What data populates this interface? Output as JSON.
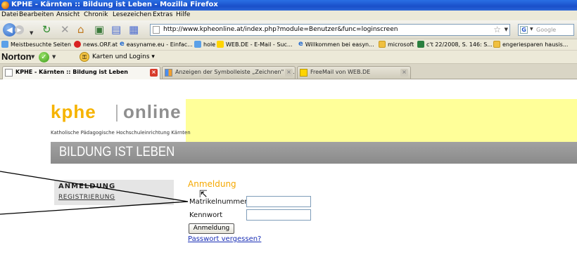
{
  "window": {
    "title": "KPHE - Kärnten :: Bildung ist Leben - Mozilla Firefox"
  },
  "menu": [
    "Datei",
    "Bearbeiten",
    "Ansicht",
    "Chronik",
    "Lesezeichen",
    "Extras",
    "Hilfe"
  ],
  "navigation": {
    "url": "http://www.kpheonline.at/index.php?module=Benutzer&func=loginscreen",
    "search_placeholder": "Google"
  },
  "bookmarks": [
    {
      "label": "Meistbesuchte Seiten",
      "icon": "page-icon"
    },
    {
      "label": "news.ORF.at",
      "icon": "orf-icon"
    },
    {
      "label": "easyname.eu - Einfac...",
      "icon": "ie-icon"
    },
    {
      "label": "hole",
      "icon": "hole-icon"
    },
    {
      "label": "WEB.DE - E-Mail - Suc...",
      "icon": "webde-icon"
    },
    {
      "label": "Willkommen bei easyn...",
      "icon": "ie-icon"
    },
    {
      "label": "microsoft",
      "icon": "folder-icon"
    },
    {
      "label": "c't 22/2008, S. 146: S...",
      "icon": "ct-icon"
    },
    {
      "label": "engeriesparen hausis...",
      "icon": "folder-icon"
    }
  ],
  "norton": {
    "brand": "Norton",
    "logins_label": "Karten und Logins"
  },
  "tabs": [
    {
      "label": "KPHE - Kärnten :: Bildung ist Leben",
      "active": true
    },
    {
      "label": "Anzeigen der Symbolleiste „Zeichnen\" - ...",
      "active": false
    },
    {
      "label": "FreeMail von WEB.DE",
      "active": false
    }
  ],
  "page": {
    "logo_part1": "kphe",
    "logo_part2": "online",
    "logo_subtitle": "Katholische Pädagogische Hochschuleinrichtung Kärnten",
    "banner": "BILDUNG IST LEBEN",
    "sidebar": {
      "anmeldung": "ANMELDUNG",
      "registrierung": "REGISTRIERUNG"
    },
    "login": {
      "title": "Anmeldung",
      "matrikel_label": "Matrikelnummer",
      "matrikel_value": "",
      "kennwort_label": "Kennwort",
      "kennwort_value": "",
      "button": "Anmeldung",
      "forgot": "Passwort vergessen?"
    }
  },
  "colors": {
    "accent": "#f5a800",
    "logo_grey": "#8f8f8f",
    "banner": "#969696",
    "yellow_band": "#ffff99",
    "link": "#1a2fb5"
  }
}
